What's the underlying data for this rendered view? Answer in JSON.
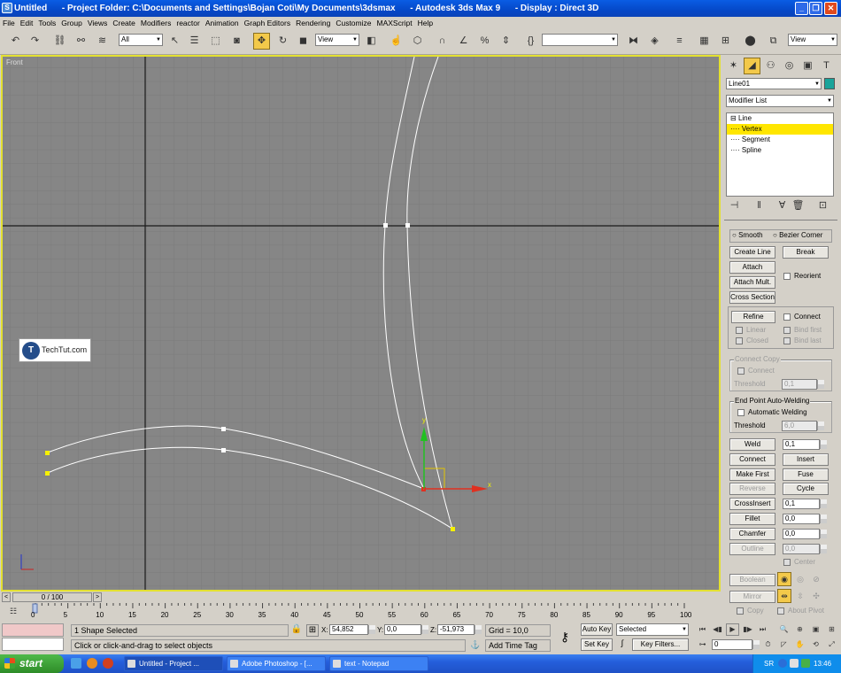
{
  "window": {
    "title": "Untitled      - Project Folder: C:\\Documents and Settings\\Bojan Coti\\My Documents\\3dsmax      - Autodesk 3ds Max 9      - Display : Direct 3D",
    "app_icon": "3dsmax-icon"
  },
  "menu": [
    "File",
    "Edit",
    "Tools",
    "Group",
    "Views",
    "Create",
    "Modifiers",
    "reactor",
    "Animation",
    "Graph Editors",
    "Rendering",
    "Customize",
    "MAXScript",
    "Help"
  ],
  "toolbar": {
    "selection_filter": "All",
    "ref_coord": "View",
    "named_selection": "",
    "view_dropdown": "View"
  },
  "viewport": {
    "label": "Front",
    "watermark": "TechTut.com",
    "watermark_logo": "T",
    "axis_x": "x",
    "axis_y": "y"
  },
  "command_panel": {
    "object_name": "Line01",
    "object_color": "#19a39a",
    "modifier_list": "Modifier List",
    "stack": [
      {
        "label": "Line",
        "prefix": "⊟ "
      },
      {
        "label": "Vertex",
        "prefix": "···· ",
        "selected": true
      },
      {
        "label": "Segment",
        "prefix": "···· "
      },
      {
        "label": "Spline",
        "prefix": "···· "
      }
    ],
    "smooth_label": "Smooth",
    "bezier_corner_label": "Bezier Corner",
    "create_line": "Create Line",
    "break": "Break",
    "attach": "Attach",
    "attach_mult": "Attach Mult.",
    "reorient": "Reorient",
    "cross_section": "Cross Section",
    "refine": "Refine",
    "connect": "Connect",
    "linear": "Linear",
    "bind_first": "Bind first",
    "closed": "Closed",
    "bind_last": "Bind last",
    "connect_copy_title": "Connect Copy",
    "connect_copy_connect": "Connect",
    "threshold_label": "Threshold",
    "cc_threshold": "0,1",
    "ep_title": "End Point Auto-Welding",
    "automatic_welding": "Automatic Welding",
    "ep_threshold": "6,0",
    "weld": "Weld",
    "weld_value": "0,1",
    "connect_btn": "Connect",
    "insert": "Insert",
    "make_first": "Make First",
    "fuse": "Fuse",
    "reverse": "Reverse",
    "cycle": "Cycle",
    "crossinsert": "CrossInsert",
    "crossinsert_value": "0,1",
    "fillet": "Fillet",
    "fillet_value": "0,0",
    "chamfer": "Chamfer",
    "chamfer_value": "0,0",
    "outline": "Outline",
    "outline_value": "0,0",
    "center": "Center",
    "boolean": "Boolean",
    "mirror": "Mirror",
    "copy": "Copy",
    "about_pivot": "About Pivot"
  },
  "timeline": {
    "slider_label": "0 / 100",
    "ticks": [
      "0",
      "5",
      "10",
      "15",
      "20",
      "25",
      "30",
      "35",
      "40",
      "45",
      "50",
      "55",
      "60",
      "65",
      "70",
      "75",
      "80",
      "85",
      "90",
      "95",
      "100"
    ]
  },
  "status": {
    "selection": "1 Shape Selected",
    "prompt": "Click or click-and-drag to select objects",
    "x_label": "X:",
    "x_value": "54,852",
    "y_label": "Y:",
    "y_value": "0,0",
    "z_label": "Z:",
    "z_value": "-51,973",
    "grid": "Grid = 10,0",
    "add_time_tag": "Add Time Tag",
    "auto_key": "Auto Key",
    "set_key": "Set Key",
    "key_mode": "Selected",
    "key_filters": "Key Filters...",
    "frame": "0"
  },
  "taskbar": {
    "start": "start",
    "tasks": [
      "Untitled    - Project ...",
      "Adobe Photoshop - [...",
      "text - Notepad"
    ],
    "lang": "SR",
    "clock": "13:46"
  }
}
